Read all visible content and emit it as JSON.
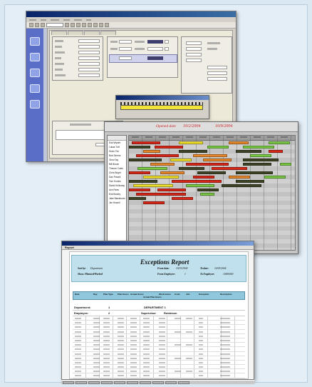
{
  "gantt": {
    "header": {
      "label": "Opened date",
      "date1": "10/2/2004",
      "date2": "10/9/2004"
    },
    "employees": [
      "Edd Wysler",
      "Lukas Tuft",
      "Kevin Tim",
      "Bob Simms",
      "Gina Kay",
      "Bill Brown",
      "Theone Coles",
      "Chris Bright",
      "Dan Powell",
      "Tom Knoles",
      "David Holloway",
      "Ann Rees",
      "Edd Bosley",
      "Jake Blackhurst",
      "Jim Howell"
    ],
    "colors": {
      "red": "#d62718",
      "orange": "#e8882a",
      "yellow": "#f0e02a",
      "green": "#7ac943",
      "dark": "#3e4426",
      "blue": "#4a6ec8"
    }
  },
  "report": {
    "toolbar_label": "Report",
    "title": "Exceptions Report",
    "sort_by_label": "Sort by:",
    "sort_by_value": "Department",
    "show_label": "Show: Planned/Worked",
    "from_date_label": "From date:",
    "from_date_value": "10/01/2004",
    "to_date_label": "To date:",
    "to_date_value": "10/03/2004",
    "from_employee_label": "From Employee:",
    "from_employee_value": "1",
    "to_employee_label": "To Employee:",
    "to_employee_value": "10000000",
    "columns": [
      "Date",
      "Day",
      "Plan Type",
      "Plan Hours",
      "Actual Hours",
      "Actual Plan Hours",
      "Work Hours",
      "Code",
      "Job",
      "Exception",
      "Description"
    ],
    "department_label": "Department:",
    "department_number": "1",
    "department_name": "DEPARTMENT 1",
    "employee_label": "Employee:",
    "employee_number": "2",
    "supervisor_label": "Supervisor",
    "supervisor_name": "Robinson"
  }
}
